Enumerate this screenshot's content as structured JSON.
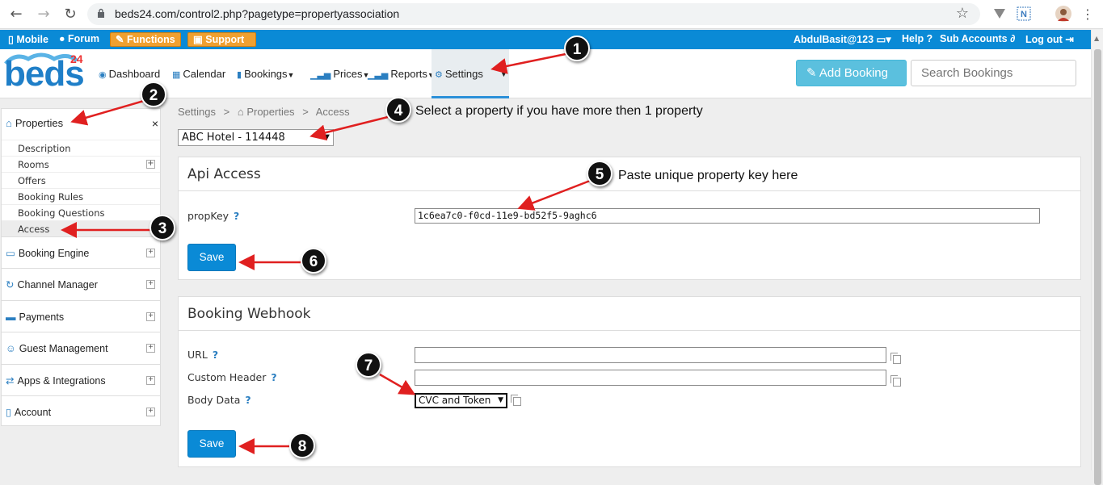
{
  "browser": {
    "url": "beds24.com/control2.php?pagetype=propertyassociation"
  },
  "topbar": {
    "mobile": "Mobile",
    "forum": "Forum",
    "functions": "Functions",
    "support": "Support",
    "user": "AbdulBasit@123",
    "help": "Help ?",
    "sub_accounts": "Sub Accounts",
    "logout": "Log out"
  },
  "header": {
    "logo": "beds",
    "logo_num": "24",
    "nav": {
      "dashboard": "Dashboard",
      "calendar": "Calendar",
      "bookings": "Bookings",
      "prices": "Prices",
      "reports": "Reports",
      "settings": "Settings"
    },
    "add_booking": "Add Booking",
    "search_placeholder": "Search Bookings"
  },
  "sidebar": {
    "properties": "Properties",
    "close": "×",
    "sub_items": [
      "Description",
      "Rooms",
      "Offers",
      "Booking Rules",
      "Booking Questions",
      "Access"
    ],
    "sections": [
      "Booking Engine",
      "Channel Manager",
      "Payments",
      "Guest Management",
      "Apps & Integrations",
      "Account"
    ]
  },
  "main": {
    "breadcrumb": {
      "settings": "Settings",
      "properties": "Properties",
      "access": "Access"
    },
    "property_select": "ABC Hotel - 114448",
    "api_access": {
      "title": "Api Access",
      "propkey_label": "propKey",
      "propkey_value": "1c6ea7c0-f0cd-11e9-bd52f5-9aghc6",
      "save": "Save"
    },
    "webhook": {
      "title": "Booking Webhook",
      "url_label": "URL",
      "custom_header_label": "Custom Header",
      "body_data_label": "Body Data",
      "body_data_value": "CVC and Token",
      "save": "Save"
    },
    "help_mark": "?"
  },
  "annotations": {
    "badges": [
      "1",
      "2",
      "3",
      "4",
      "5",
      "6",
      "7",
      "8"
    ],
    "note_4": "Select a property if you have more then 1 property",
    "note_5": "Paste unique property key here"
  },
  "colors": {
    "primary_blue": "#0a8ad6",
    "orange": "#f0a030",
    "info_blue": "#5bc0de",
    "arrow_red": "#e02020"
  }
}
